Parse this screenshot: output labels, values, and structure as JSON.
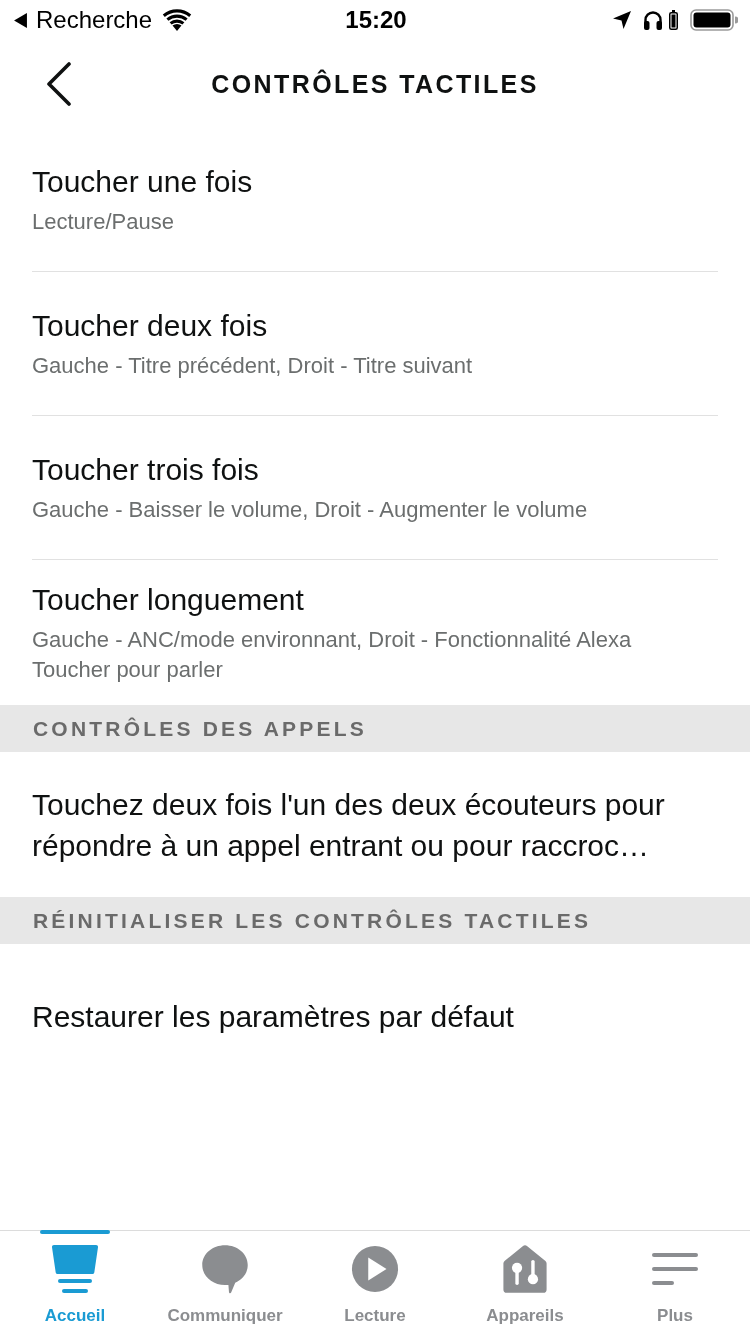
{
  "status_bar": {
    "back_label": "Recherche",
    "time": "15:20"
  },
  "header": {
    "title": "CONTRÔLES TACTILES"
  },
  "touch_controls": [
    {
      "title": "Toucher une fois",
      "value": "Lecture/Pause"
    },
    {
      "title": "Toucher deux fois",
      "value": "Gauche - Titre précédent, Droit - Titre suivant"
    },
    {
      "title": "Toucher trois fois",
      "value": "Gauche - Baisser le volume, Droit - Augmenter le volume"
    },
    {
      "title": "Toucher longuement",
      "value": "Gauche - ANC/mode environnant, Droit - Fonctionnalité Alexa Toucher pour parler"
    }
  ],
  "call_controls": {
    "header": "CONTRÔLES DES APPELS",
    "text": "Touchez deux fois l'un des deux écouteurs pour répondre à un appel entrant ou pour raccroc…"
  },
  "reset": {
    "header": "RÉINITIALISER LES CONTRÔLES TACTILES",
    "action": "Restaurer les paramètres par défaut"
  },
  "tab_bar": [
    {
      "label": "Accueil",
      "selected": true
    },
    {
      "label": "Communiquer",
      "selected": false
    },
    {
      "label": "Lecture",
      "selected": false
    },
    {
      "label": "Appareils",
      "selected": false
    },
    {
      "label": "Plus",
      "selected": false
    }
  ]
}
